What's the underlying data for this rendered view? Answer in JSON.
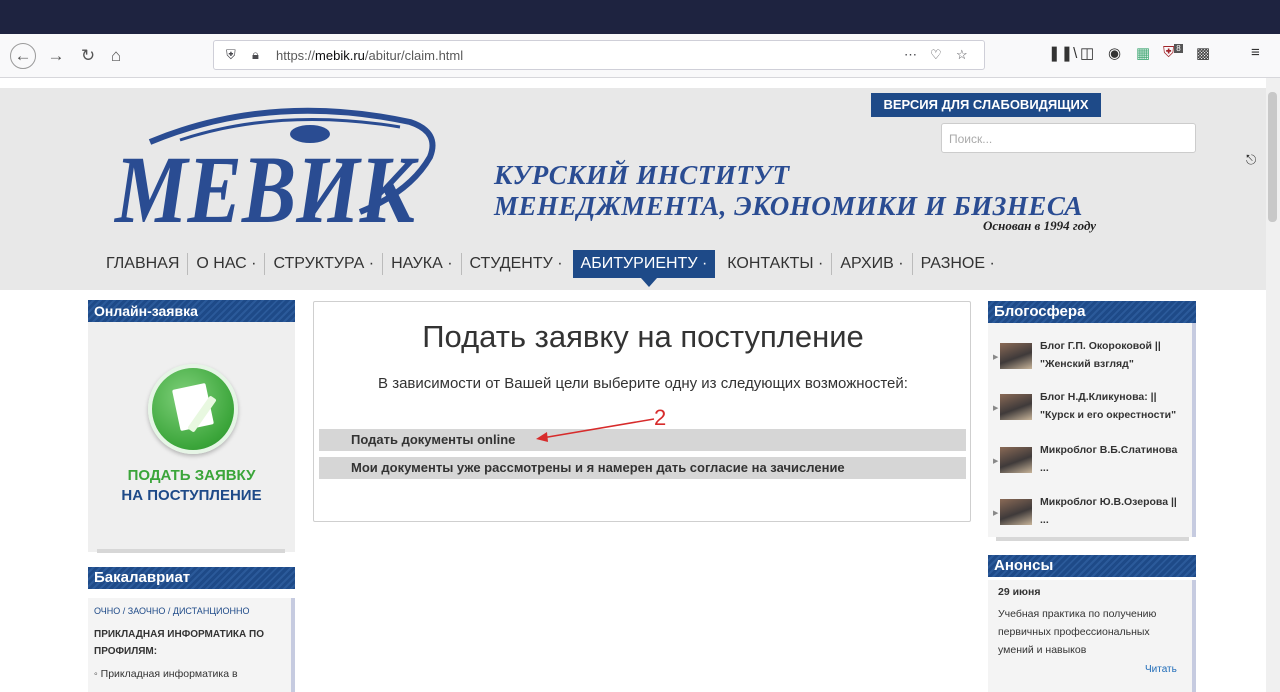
{
  "browser": {
    "url_prefix": "https://",
    "url_domain": "mebik.ru",
    "url_path": "/abitur/claim.html",
    "toolbar_icons": [
      "back-icon",
      "forward-icon",
      "reload-icon",
      "home-icon",
      "shield-icon",
      "lock-icon",
      "more-icon",
      "pocket-icon",
      "bookmark-star-icon",
      "library-icon",
      "sidebar-icon",
      "account-icon",
      "extension-icon",
      "ublock-icon",
      "wallet-icon",
      "menu-icon"
    ],
    "ublock_badge": "8"
  },
  "header": {
    "logo_text": "МЕВИК",
    "title_line1": "КУРСКИЙ ИНСТИТУТ",
    "title_line2": "МЕНЕДЖМЕНТА, ЭКОНОМИКИ И БИЗНЕСА",
    "founded": "Основан в 1994 году",
    "vision_button": "ВЕРСИЯ ДЛЯ СЛАБОВИДЯЩИХ",
    "search_placeholder": "Поиск..."
  },
  "nav": {
    "items": [
      "ГЛАВНАЯ",
      "О НАС ·",
      "СТРУКТУРА ·",
      "НАУКА ·",
      "СТУДЕНТУ ·",
      "АБИТУРИЕНТУ ·",
      "КОНТАКТЫ ·",
      "АРХИВ ·",
      "РАЗНОЕ ·"
    ],
    "active_index": 5
  },
  "left": {
    "online_header": "Онлайн-заявка",
    "apply_line1": "ПОДАТЬ ЗАЯВКУ",
    "apply_line2": "НА ПОСТУПЛЕНИЕ",
    "bachelor_header": "Бакалавриат",
    "bachelor_mode": "ОЧНО / ЗАОЧНО / ДИСТАНЦИОННО",
    "bachelor_heading": "ПРИКЛАДНАЯ ИНФОРМАТИКА ПО ПРОФИЛЯМ:",
    "bachelor_item": "Прикладная информатика в"
  },
  "main": {
    "title": "Подать заявку на поступление",
    "subtitle": "В зависимости от Вашей цели выберите одну из следующих возможностей:",
    "options": [
      "Подать документы online",
      "Мои документы уже рассмотрены и я намерен дать согласие на зачисление"
    ],
    "annotation_number": "2"
  },
  "right": {
    "blog_header": "Блогосфера",
    "blogs": [
      {
        "line1": "Блог Г.П. Окороковой ||",
        "line2": "\"Женский взгляд\""
      },
      {
        "line1": "Блог Н.Д.Кликунова: ||",
        "line2": "\"Курск и его окрестности\""
      },
      {
        "line1": "Микроблог В.Б.Слатинова",
        "line2": "..."
      },
      {
        "line1": "Микроблог Ю.В.Озерова ||",
        "line2": "..."
      }
    ],
    "news_header": "Анонсы",
    "news_date": "29 июня",
    "news_text": "Учебная практика по получению первичных профессиональных умений и навыков",
    "news_read": "Читать"
  },
  "colors": {
    "brand_blue": "#1e4a88",
    "apply_green": "#3ba53a",
    "annotation_red": "#d72b2b"
  }
}
